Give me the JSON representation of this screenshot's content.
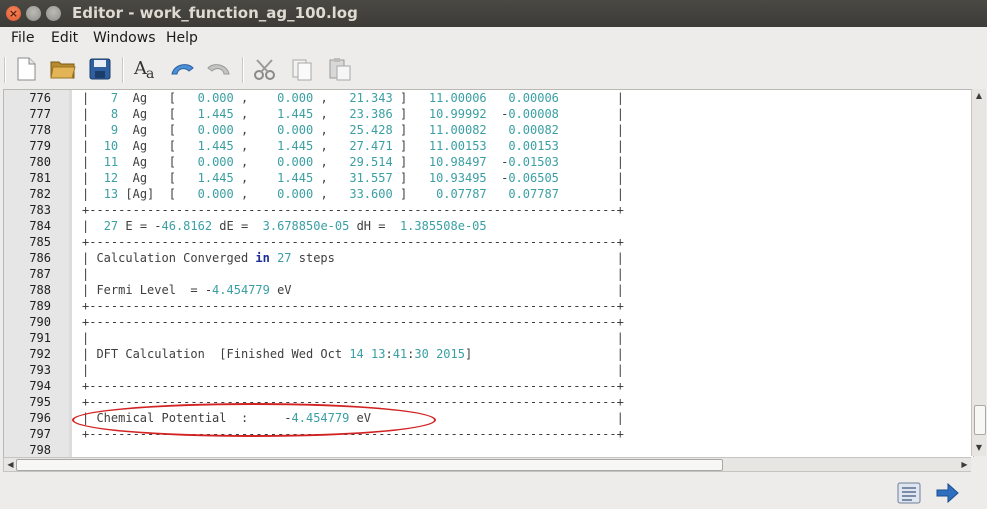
{
  "window": {
    "title": "Editor - work_function_ag_100.log"
  },
  "menu": [
    "File",
    "Edit",
    "Windows",
    "Help"
  ],
  "toolbar": {
    "icons": [
      "new-file-icon",
      "open-folder-icon",
      "save-icon",
      "font-icon",
      "undo-icon",
      "redo-icon",
      "cut-icon",
      "copy-icon",
      "paste-icon"
    ]
  },
  "editor": {
    "line_numbers": [
      "776",
      "777",
      "778",
      "779",
      "780",
      "781",
      "782",
      "783",
      "784",
      "785",
      "786",
      "787",
      "788",
      "789",
      "790",
      "791",
      "792",
      "793",
      "794",
      "795",
      "796",
      "797",
      "798"
    ],
    "lines": [
      "|   7  Ag   [   0.000 ,    0.000 ,   21.343 ]   11.00006   0.00006        |",
      "|   8  Ag   [   1.445 ,    1.445 ,   23.386 ]   10.99992  -0.00008        |",
      "|   9  Ag   [   0.000 ,    0.000 ,   25.428 ]   11.00082   0.00082        |",
      "|  10  Ag   [   1.445 ,    1.445 ,   27.471 ]   11.00153   0.00153        |",
      "|  11  Ag   [   0.000 ,    0.000 ,   29.514 ]   10.98497  -0.01503        |",
      "|  12  Ag   [   1.445 ,    1.445 ,   31.557 ]   10.93495  -0.06505        |",
      "|  13 [Ag]  [   0.000 ,    0.000 ,   33.600 ]    0.07787   0.07787        |",
      "+-------------------------------------------------------------------------+",
      "|  27 E = -46.8162 dE =  3.678850e-05 dH =  1.385508e-05                  ",
      "+-------------------------------------------------------------------------+",
      "| Calculation Converged in 27 steps                                       |",
      "|                                                                         |",
      "| Fermi Level  = -4.454779 eV                                             |",
      "+-------------------------------------------------------------------------+",
      "+-------------------------------------------------------------------------+",
      "|                                                                         |",
      "| DFT Calculation  [Finished Wed Oct 14 13:41:30 2015]                    |",
      "|                                                                         |",
      "+-------------------------------------------------------------------------+",
      "+-------------------------------------------------------------------------+",
      "| Chemical Potential  :     -4.454779 eV                                  |",
      "+-------------------------------------------------------------------------+",
      ""
    ]
  },
  "status": {
    "icons": [
      "document-list-icon",
      "forward-arrow-icon"
    ]
  },
  "colors": {
    "number": "#3a9fa3",
    "keyword": "#1d2e99",
    "highlight": "#d22222"
  }
}
